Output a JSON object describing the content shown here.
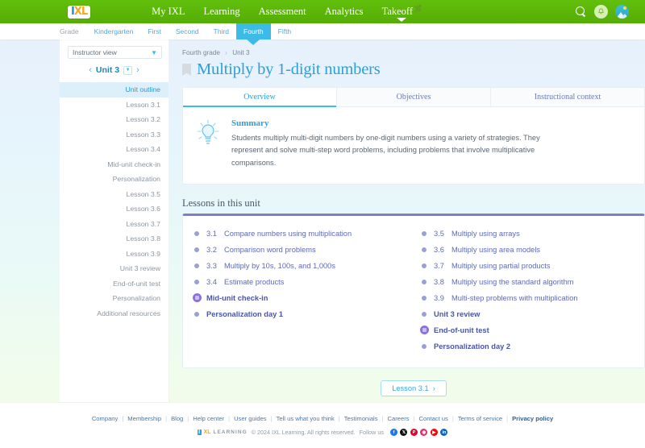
{
  "topnav": {
    "logo": {
      "i": "I",
      "xl": "XL"
    },
    "links": [
      {
        "label": "My IXL",
        "name": "nav-my-ixl",
        "active": false
      },
      {
        "label": "Learning",
        "name": "nav-learning",
        "active": false
      },
      {
        "label": "Assessment",
        "name": "nav-assessment",
        "active": false
      },
      {
        "label": "Analytics",
        "name": "nav-analytics",
        "active": false
      },
      {
        "label": "Takeoff",
        "name": "nav-takeoff",
        "active": true
      }
    ],
    "icons": [
      "search-icon",
      "notification-bell-icon",
      "user-avatar"
    ],
    "background_color": "#5cb80a"
  },
  "gradebar": {
    "label": "Grade",
    "tabs": [
      "Kindergarten",
      "First",
      "Second",
      "Third",
      "Fourth",
      "Fifth"
    ],
    "selected": "Fourth",
    "selected_color": "#3dbbe8"
  },
  "sidebar": {
    "view_selector": "Instructor view",
    "unit": "Unit 3",
    "items": [
      {
        "label": "Unit outline",
        "active": true
      },
      {
        "label": "Lesson 3.1",
        "active": false
      },
      {
        "label": "Lesson 3.2",
        "active": false
      },
      {
        "label": "Lesson 3.3",
        "active": false
      },
      {
        "label": "Lesson 3.4",
        "active": false
      },
      {
        "label": "Mid-unit check-in",
        "active": false
      },
      {
        "label": "Personalization",
        "active": false
      },
      {
        "label": "Lesson 3.5",
        "active": false
      },
      {
        "label": "Lesson 3.6",
        "active": false
      },
      {
        "label": "Lesson 3.7",
        "active": false
      },
      {
        "label": "Lesson 3.8",
        "active": false
      },
      {
        "label": "Lesson 3.9",
        "active": false
      },
      {
        "label": "Unit 3 review",
        "active": false
      },
      {
        "label": "End-of-unit test",
        "active": false
      },
      {
        "label": "Personalization",
        "active": false
      },
      {
        "label": "Additional resources",
        "active": false
      }
    ]
  },
  "main": {
    "breadcrumb": [
      "Fourth grade",
      "Unit 3"
    ],
    "title": "Multiply by 1-digit numbers",
    "tabs": [
      {
        "label": "Overview",
        "active": true
      },
      {
        "label": "Objectives",
        "active": false
      },
      {
        "label": "Instructional context",
        "active": false
      }
    ],
    "summary": {
      "heading": "Summary",
      "text": "Students multiply multi-digit numbers by one-digit numbers using a variety of strategies. They represent and solve multi-step word problems, including problems that involve multiplicative comparisons."
    },
    "lessons_section_title": "Lessons in this unit",
    "lessons_left": [
      {
        "num": "3.1",
        "label": "Compare numbers using multiplication",
        "bold": false,
        "icon": "dot"
      },
      {
        "num": "3.2",
        "label": "Comparison word problems",
        "bold": false,
        "icon": "dot"
      },
      {
        "num": "3.3",
        "label": "Multiply by 10s, 100s, and 1,000s",
        "bold": false,
        "icon": "dot"
      },
      {
        "num": "3.4",
        "label": "Estimate products",
        "bold": false,
        "icon": "dot"
      },
      {
        "num": "",
        "label": "Mid-unit check-in",
        "bold": true,
        "icon": "checkin-badge"
      },
      {
        "num": "",
        "label": "Personalization day 1",
        "bold": true,
        "icon": "dot"
      }
    ],
    "lessons_right": [
      {
        "num": "3.5",
        "label": "Multiply using arrays",
        "bold": false,
        "icon": "dot"
      },
      {
        "num": "3.6",
        "label": "Multiply using area models",
        "bold": false,
        "icon": "dot"
      },
      {
        "num": "3.7",
        "label": "Multiply using partial products",
        "bold": false,
        "icon": "dot"
      },
      {
        "num": "3.8",
        "label": "Multiply using the standard algorithm",
        "bold": false,
        "icon": "dot"
      },
      {
        "num": "3.9",
        "label": "Multi-step problems with multiplication",
        "bold": false,
        "icon": "dot"
      },
      {
        "num": "",
        "label": "Unit 3 review",
        "bold": true,
        "icon": "dot"
      },
      {
        "num": "",
        "label": "End-of-unit test",
        "bold": true,
        "icon": "checkin-badge"
      },
      {
        "num": "",
        "label": "Personalization day 2",
        "bold": true,
        "icon": "dot"
      }
    ],
    "next_button": "Lesson 3.1",
    "accent_color": "#7b7fc4"
  },
  "footer": {
    "links": [
      {
        "label": "Company",
        "bold": false
      },
      {
        "label": "Membership",
        "bold": false
      },
      {
        "label": "Blog",
        "bold": false
      },
      {
        "label": "Help center",
        "bold": false
      },
      {
        "label": "User guides",
        "bold": false
      },
      {
        "label": "Tell us what you think",
        "bold": false
      },
      {
        "label": "Testimonials",
        "bold": false
      },
      {
        "label": "Careers",
        "bold": false
      },
      {
        "label": "Contact us",
        "bold": false
      },
      {
        "label": "Terms of service",
        "bold": false
      },
      {
        "label": "Privacy policy",
        "bold": true
      }
    ],
    "logo_i": "I",
    "logo_xl": "XL",
    "logo_word": "LEARNING",
    "copyright": "© 2024 IXL Learning. All rights reserved.",
    "follow_us": "Follow us",
    "socials": [
      {
        "name": "facebook-icon",
        "glyph": "f",
        "color": "#1877f2"
      },
      {
        "name": "x-twitter-icon",
        "glyph": "𝕏",
        "color": "#0f0f0f"
      },
      {
        "name": "pinterest-icon",
        "glyph": "P",
        "color": "#e60023"
      },
      {
        "name": "instagram-icon",
        "glyph": "◉",
        "color": "#e1306c"
      },
      {
        "name": "youtube-icon",
        "glyph": "▶",
        "color": "#ff0000"
      },
      {
        "name": "linkedin-icon",
        "glyph": "in",
        "color": "#0a66c2"
      }
    ]
  }
}
